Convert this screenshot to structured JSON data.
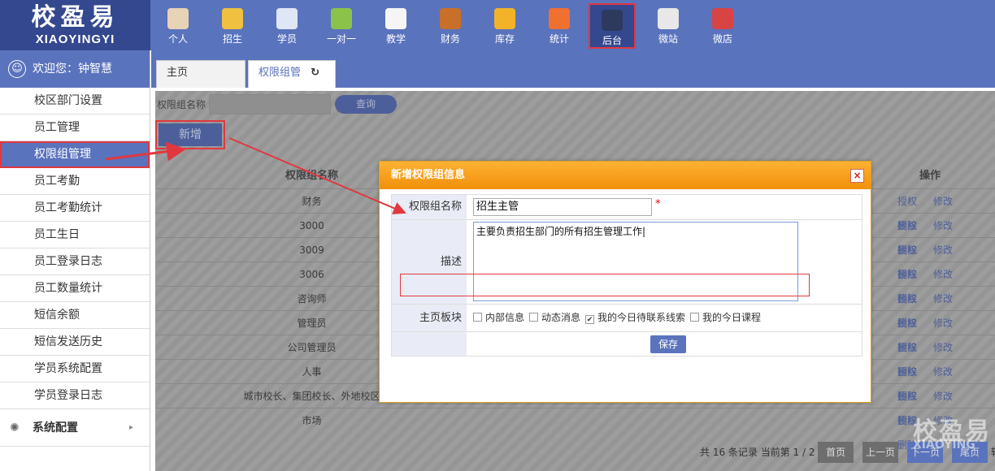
{
  "logo": {
    "cn": "校盈易",
    "en": "XIAOYINGYI"
  },
  "nav": [
    {
      "label": "个人",
      "icon": "person-icon",
      "color": "#e7d3b5"
    },
    {
      "label": "招生",
      "icon": "search-person-icon",
      "color": "#f0c040"
    },
    {
      "label": "学员",
      "icon": "student-card-icon",
      "color": "#dfe6f5"
    },
    {
      "label": "一对一",
      "icon": "chat-bubble-icon",
      "color": "#8bc34a"
    },
    {
      "label": "教学",
      "icon": "pencil-board-icon",
      "color": "#f5f5f5"
    },
    {
      "label": "财务",
      "icon": "briefcase-icon",
      "color": "#c8702a"
    },
    {
      "label": "库存",
      "icon": "pie-chart-icon",
      "color": "#f3b329"
    },
    {
      "label": "统计",
      "icon": "bar-chart-icon",
      "color": "#f07030"
    },
    {
      "label": "后台",
      "icon": "monitor-icon",
      "color": "#2d3a5e"
    },
    {
      "label": "微站",
      "icon": "web-page-icon",
      "color": "#e8e8e8"
    },
    {
      "label": "微店",
      "icon": "store-icon",
      "color": "#d84444"
    }
  ],
  "sidebar": {
    "welcome": "欢迎您：钟智慧",
    "items": [
      "校区部门设置",
      "员工管理",
      "权限组管理",
      "员工考勤",
      "员工考勤统计",
      "员工生日",
      "员工登录日志",
      "员工数量统计",
      "短信余额",
      "短信发送历史",
      "学员系统配置",
      "学员登录日志"
    ],
    "group": "系统配置"
  },
  "tabs": {
    "home": "主页",
    "current": "权限组管",
    "refresh": "C",
    "close": "✕"
  },
  "search": {
    "label": "权限组名称",
    "button": "查询",
    "new_button": "新增"
  },
  "table": {
    "header_name": "权限组名称",
    "header_ops": "操作",
    "rows": [
      "财务",
      "3000",
      "3009",
      "3006",
      "咨询师",
      "管理员",
      "公司管理员",
      "人事",
      "城市校长、集团校长、外地校区",
      "市场"
    ],
    "op_labels": [
      "授权",
      "修改",
      "删除"
    ]
  },
  "pager": {
    "info": "共 16 条记录 当前第 1 / 2",
    "first": "首页",
    "prev": "上一页",
    "next": "下一页",
    "last": "尾页",
    "tail": "转"
  },
  "watermark": {
    "cn": "校盈易",
    "en": "XIAOYING"
  },
  "dialog": {
    "title": "新增权限组信息",
    "close": "×",
    "name_label": "权限组名称",
    "name_value": "招生主管",
    "required_mark": "*",
    "desc_label": "描述",
    "desc_value": "主要负责招生部门的所有招生管理工作|",
    "module_label": "主页板块",
    "modules": [
      {
        "label": "内部信息",
        "checked": false
      },
      {
        "label": "动态消息",
        "checked": false
      },
      {
        "label": "我的今日待联系线索",
        "checked": true
      },
      {
        "label": "我的今日课程",
        "checked": false
      }
    ],
    "save": "保存"
  },
  "colors": {
    "primary": "#5a73bd",
    "highlight": "#e0383e",
    "dialog_header": "#f39c12"
  }
}
